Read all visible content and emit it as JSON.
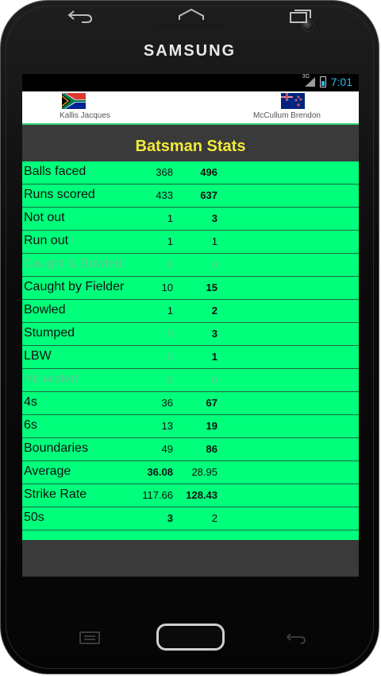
{
  "device": {
    "brand": "SAMSUNG"
  },
  "statusbar": {
    "network": "3G",
    "time": "7:01"
  },
  "players": {
    "left": {
      "name": "Kallis Jacques",
      "flag": "south-africa-flag"
    },
    "right": {
      "name": "McCullum Brendon",
      "flag": "new-zealand-flag"
    }
  },
  "title": "Batsman Stats",
  "stats": [
    {
      "label": "Balls faced",
      "left": "368",
      "right": "496",
      "bold": "right",
      "dim": false
    },
    {
      "label": "Runs scored",
      "left": "433",
      "right": "637",
      "bold": "right",
      "dim": false
    },
    {
      "label": "Not out",
      "left": "1",
      "right": "3",
      "bold": "right",
      "dim": false
    },
    {
      "label": "Run out",
      "left": "1",
      "right": "1",
      "bold": "none",
      "dim": false
    },
    {
      "label": "Caught & Bowled",
      "left": "0",
      "right": "0",
      "bold": "none",
      "dim": true
    },
    {
      "label": "Caught by Fielder",
      "left": "10",
      "right": "15",
      "bold": "right",
      "dim": false
    },
    {
      "label": "Bowled",
      "left": "1",
      "right": "2",
      "bold": "right",
      "dim": false
    },
    {
      "label": "Stumped",
      "left": "0",
      "right": "3",
      "bold": "right",
      "dim": false,
      "leftDim": true
    },
    {
      "label": "LBW",
      "left": "0",
      "right": "1",
      "bold": "right",
      "dim": false,
      "leftDim": true
    },
    {
      "label": "Hit wicket",
      "left": "0",
      "right": "0",
      "bold": "none",
      "dim": true
    },
    {
      "label": "4s",
      "left": "36",
      "right": "67",
      "bold": "right",
      "dim": false
    },
    {
      "label": "6s",
      "left": "13",
      "right": "19",
      "bold": "right",
      "dim": false
    },
    {
      "label": "Boundaries",
      "left": "49",
      "right": "86",
      "bold": "right",
      "dim": false
    },
    {
      "label": "Average",
      "left": "36.08",
      "right": "28.95",
      "bold": "left",
      "dim": false
    },
    {
      "label": "Strike Rate",
      "left": "117.66",
      "right": "128.43",
      "bold": "right",
      "dim": false
    },
    {
      "label": "50s",
      "left": "3",
      "right": "2",
      "bold": "left",
      "dim": false
    }
  ],
  "colors": {
    "table_bg": "#00ff7b",
    "title": "#f2ea3a",
    "accent": "#33b5e5"
  },
  "hardware_keys": [
    "back-key-icon",
    "home-key-icon",
    "recent-apps-key-icon",
    "menu-key-icon",
    "return-key-icon"
  ]
}
